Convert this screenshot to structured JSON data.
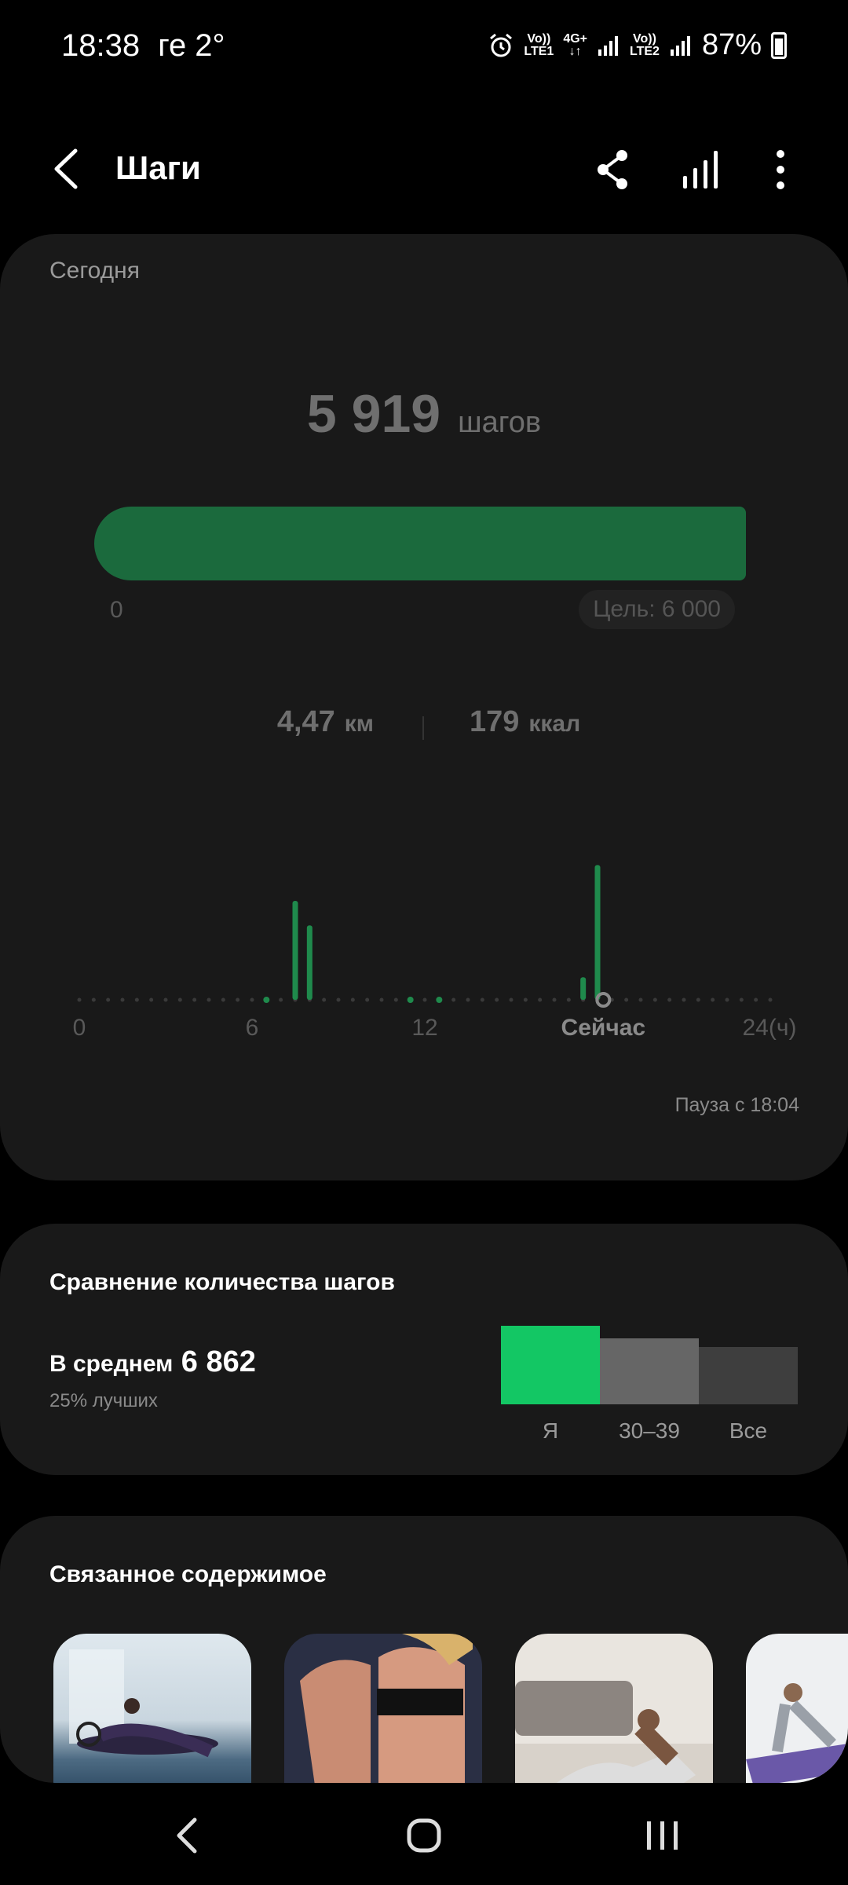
{
  "status": {
    "time": "18:38",
    "extra": "ге 2°",
    "sim1": [
      "Vo))",
      "LTE1"
    ],
    "net": [
      "4G+",
      "↓↑"
    ],
    "sim2": [
      "Vo))",
      "LTE2"
    ],
    "battery": "87%"
  },
  "header": {
    "title": "Шаги"
  },
  "today": {
    "label": "Сегодня",
    "steps": "5 919",
    "steps_unit": "шагов",
    "progress_fraction": 0.9865,
    "progress_start": "0",
    "goal": "Цель: 6 000",
    "distance": "4,47",
    "distance_unit": "км",
    "calories": "179",
    "calories_unit": "ккал",
    "pause": "Пауза с 18:04"
  },
  "chart_data": {
    "type": "bar",
    "title": "",
    "x_ticks": [
      "0",
      "6",
      "12",
      "Сейчас",
      "24(ч)"
    ],
    "x_tick_hours": [
      0,
      6,
      12,
      18.2,
      24
    ],
    "current_hour": 18.2,
    "hours": [
      0,
      0.5,
      1,
      1.5,
      2,
      2.5,
      3,
      3.5,
      4,
      4.5,
      5,
      5.5,
      6,
      6.5,
      7,
      7.5,
      8,
      8.5,
      9,
      9.5,
      10,
      10.5,
      11,
      11.5,
      12,
      12.5,
      13,
      13.5,
      14,
      14.5,
      15,
      15.5,
      16,
      16.5,
      17,
      17.5,
      18,
      18.5,
      19,
      19.5,
      20,
      20.5,
      21,
      21.5,
      22,
      22.5,
      23,
      23.5
    ],
    "values": [
      0,
      0,
      0,
      0,
      0,
      0,
      0,
      0,
      0,
      0,
      0,
      0,
      0,
      0,
      0,
      1050,
      790,
      0,
      0,
      0,
      0,
      0,
      0,
      0,
      0,
      0,
      0,
      0,
      0,
      0,
      0,
      0,
      0,
      0,
      0,
      240,
      1430,
      0,
      0,
      0,
      0,
      0,
      0,
      0,
      0,
      0,
      0,
      0
    ],
    "small_activity_hours": [
      6.5,
      11.5,
      12.5
    ],
    "bar_color": "#1f8a4c"
  },
  "comparison": {
    "title": "Сравнение количества шагов",
    "avg_label": "В среднем",
    "avg_value": "6 862",
    "percentile": "25% лучших",
    "chart_data": {
      "type": "bar",
      "categories": [
        "Я",
        "30–39",
        "Все"
      ],
      "values": [
        5919,
        4950,
        4300
      ],
      "colors": [
        "#13c764",
        "#666666",
        "#3e3e3e"
      ]
    }
  },
  "related": {
    "title": "Связанное содержимое",
    "items": [
      "workout-1",
      "workout-2",
      "workout-3",
      "workout-4"
    ]
  },
  "nav": {
    "items": [
      "back",
      "home",
      "recents"
    ]
  }
}
